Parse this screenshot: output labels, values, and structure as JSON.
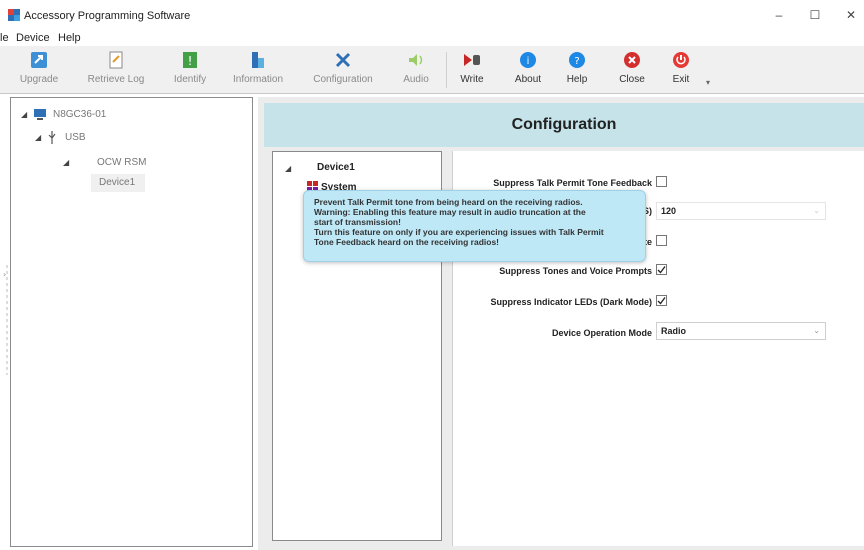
{
  "window": {
    "title": "Accessory Programming Software",
    "controls": {
      "minimize": "–",
      "maximize": "☐",
      "close": "✕"
    }
  },
  "menubar": {
    "items": [
      "le",
      "Device",
      "Help"
    ]
  },
  "toolbar": {
    "buttons": [
      {
        "label": "Upgrade",
        "icon": "upgrade-icon",
        "enabled": false
      },
      {
        "label": "Retrieve Log",
        "icon": "retrieve-log-icon",
        "enabled": false
      },
      {
        "label": "Identify",
        "icon": "identify-icon",
        "enabled": false
      },
      {
        "label": "Information",
        "icon": "information-icon",
        "enabled": false
      },
      {
        "label": "Configuration",
        "icon": "configuration-icon",
        "enabled": false
      },
      {
        "label": "Audio",
        "icon": "audio-icon",
        "enabled": false
      },
      {
        "label": "Write",
        "icon": "write-icon",
        "enabled": true
      },
      {
        "label": "About",
        "icon": "about-icon",
        "enabled": true
      },
      {
        "label": "Help",
        "icon": "help-icon",
        "enabled": true
      },
      {
        "label": "Close",
        "icon": "close-icon",
        "enabled": true
      },
      {
        "label": "Exit",
        "icon": "exit-icon",
        "enabled": true
      }
    ]
  },
  "tree": {
    "computer": "N8GC36-01",
    "usb": "USB",
    "device_group": "OCW RSM",
    "device": "Device1"
  },
  "config": {
    "title": "Configuration",
    "device_tree": {
      "device": "Device1",
      "node": "System"
    },
    "settings": {
      "suppress_tpt_feedback": {
        "label": "Suppress Talk Permit Tone Feedback",
        "checked": false
      },
      "partial_value_label": "S)",
      "partial_value": "120",
      "partial_checkbox_label": "te",
      "partial_checkbox_checked": false,
      "suppress_tones_voice": {
        "label": "Suppress Tones and Voice Prompts",
        "checked": true
      },
      "suppress_leds": {
        "label": "Suppress Indicator LEDs (Dark Mode)",
        "checked": true
      },
      "device_operation_mode": {
        "label": "Device Operation Mode",
        "value": "Radio"
      }
    },
    "tooltip": {
      "lines": [
        "Prevent Talk Permit tone from being heard on the receiving radios.",
        "Warning:  Enabling this feature may result in audio truncation at the",
        "start of transmission!",
        "Turn this feature on only if you are experiencing issues with Talk Permit",
        "Tone Feedback heard on the receiving radios!"
      ]
    }
  },
  "colors": {
    "header_bg": "#c5e3e8",
    "tooltip_bg": "#bfe8f7",
    "toolbar_bg": "#f0f0f0"
  }
}
